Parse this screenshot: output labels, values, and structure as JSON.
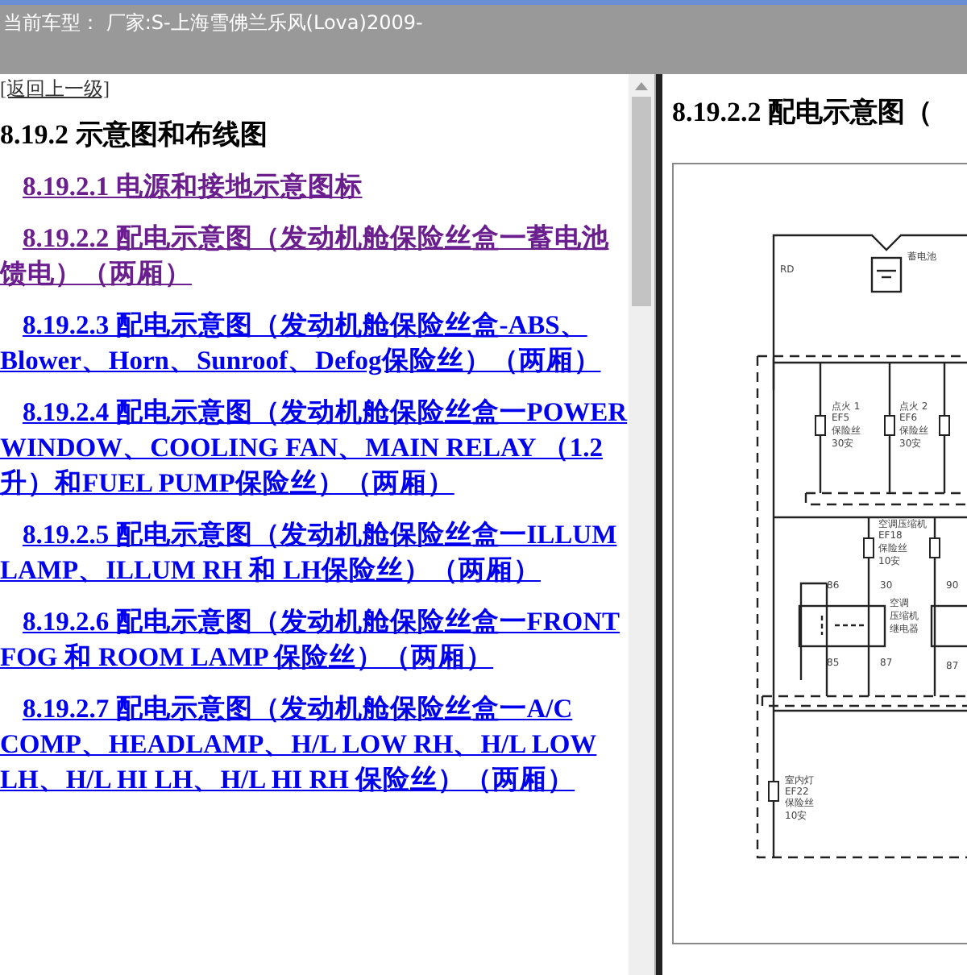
{
  "header": {
    "title": "当前车型： 厂家:S-上海雪佛兰乐风(Lova)2009-"
  },
  "left_pane": {
    "back_link": "[返回上一级]",
    "heading": "8.19.2 示意图和布线图",
    "links": [
      {
        "text": "8.19.2.1 电源和接地示意图标",
        "visited": true
      },
      {
        "text": "8.19.2.2 配电示意图（发动机舱保险丝盒一蓄电池馈电）（两厢）",
        "visited": true
      },
      {
        "text": "8.19.2.3 配电示意图（发动机舱保险丝盒-ABS、Blower、Horn、Sunroof、Defog保险丝）（两厢）",
        "visited": false
      },
      {
        "text": "8.19.2.4 配电示意图（发动机舱保险丝盒一POWER WINDOW、COOLING FAN、MAIN RELAY （1.2升）和FUEL PUMP保险丝）（两厢）",
        "visited": false
      },
      {
        "text": "8.19.2.5 配电示意图（发动机舱保险丝盒一ILLUM LAMP、ILLUM RH 和 LH保险丝）（两厢）",
        "visited": false
      },
      {
        "text": "8.19.2.6 配电示意图（发动机舱保险丝盒一FRONT FOG 和 ROOM LAMP 保险丝）（两厢）",
        "visited": false
      },
      {
        "text": "8.19.2.7 配电示意图（发动机舱保险丝盒一A/C COMP、HEADLAMP、H/L LOW RH、H/L LOW LH、H/L HI LH、H/L HI RH 保险丝）（两厢）",
        "visited": false
      }
    ]
  },
  "right_pane": {
    "heading": "8.19.2.2 配电示意图（",
    "diagram": {
      "labels": [
        "RD",
        "蓄电池",
        "点火 1",
        "EF5",
        "保险丝",
        "30安",
        "点火 2",
        "EF6",
        "保险丝",
        "30安",
        "空调压缩机",
        "EF18",
        "保险丝",
        "10安",
        "86",
        "30",
        "90",
        "空调",
        "压缩机",
        "继电器",
        "85",
        "87",
        "87",
        "室内灯",
        "EF22",
        "保险丝",
        "10安"
      ]
    }
  }
}
